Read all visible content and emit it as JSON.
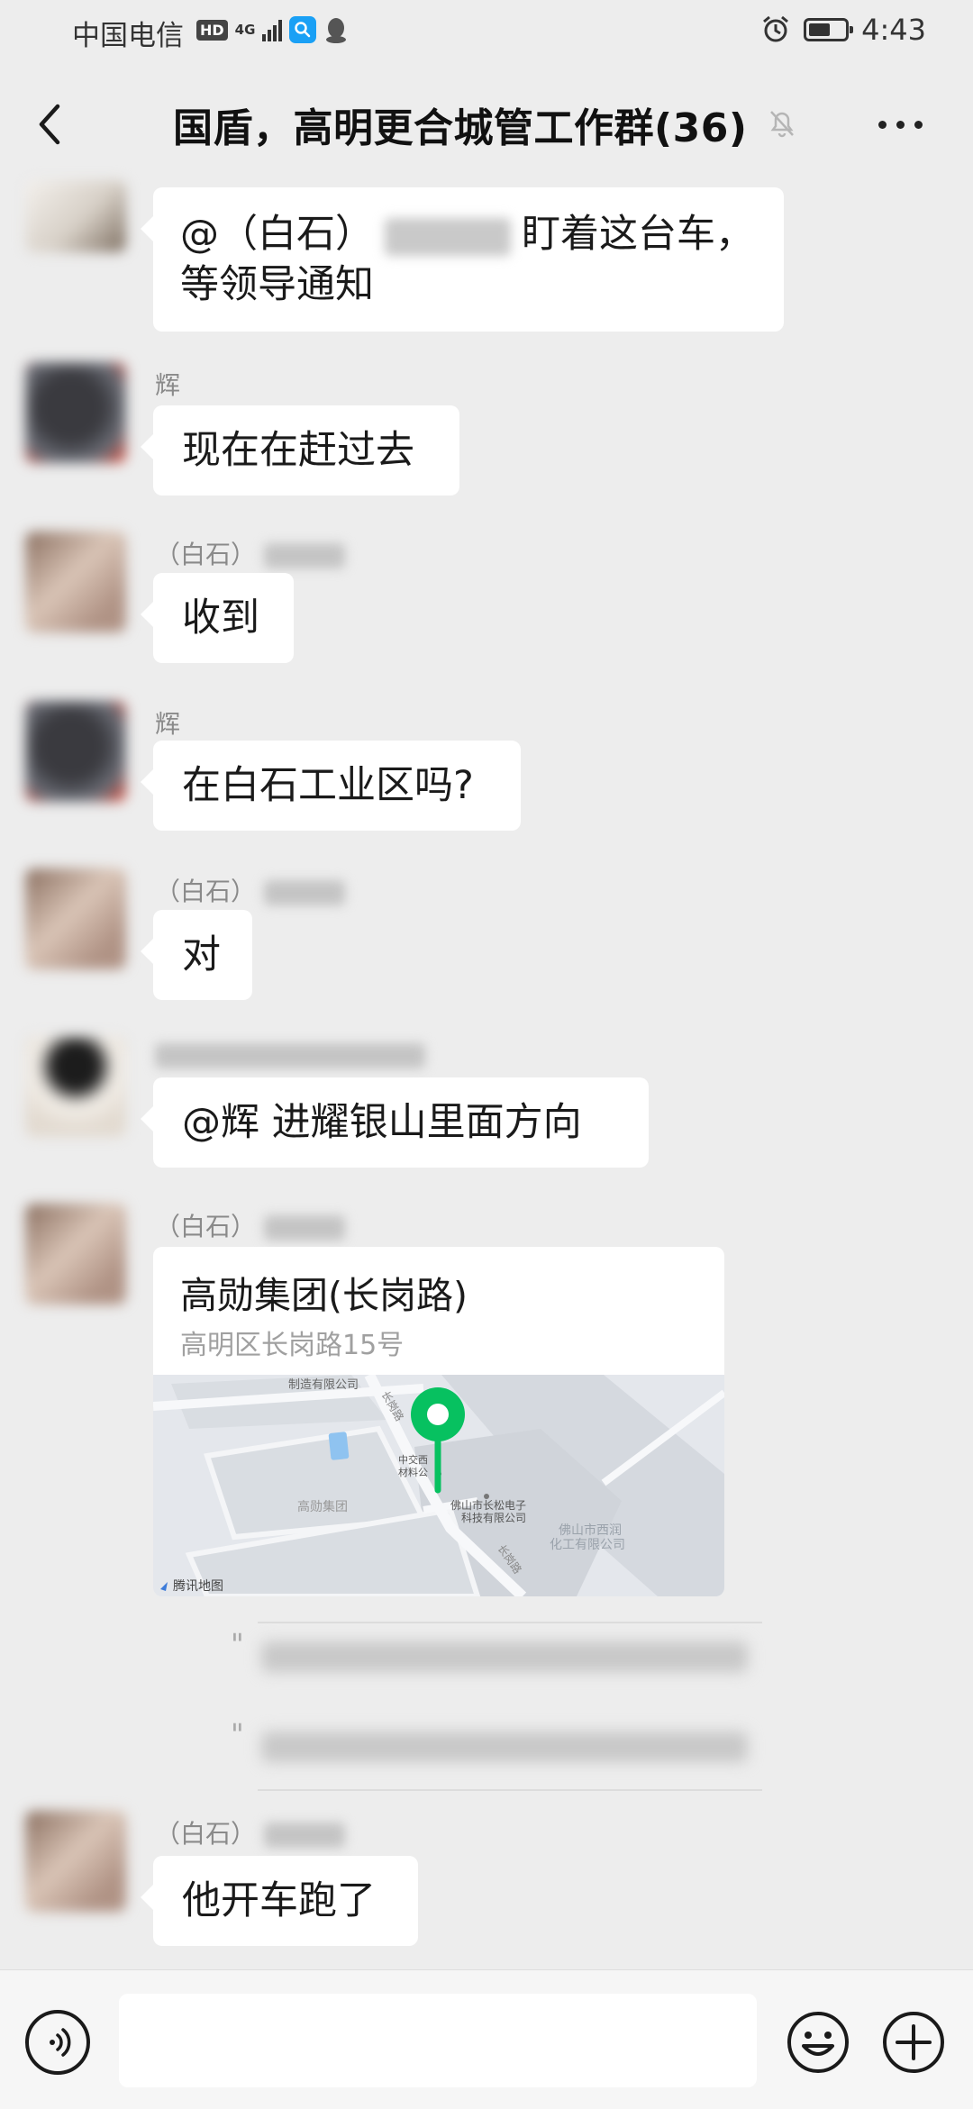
{
  "status_bar": {
    "carrier": "中国电信",
    "hd": "HD",
    "network": "4G",
    "time": "4:43",
    "battery_level": 0.6
  },
  "nav": {
    "title": "国盾，高明更合城管工作群(36)",
    "back_icon": "chevron-left-icon",
    "mute_icon": "bell-off-icon",
    "more_icon": "more-dots-icon"
  },
  "messages": [
    {
      "sender": "",
      "text_before": "@（白石）",
      "text_after": "盯着这台车，",
      "text_line2": "等领导通知"
    },
    {
      "sender": "辉",
      "text": "现在在赶过去"
    },
    {
      "sender": "（白石）",
      "text": "收到"
    },
    {
      "sender": "辉",
      "text": "在白石工业区吗?"
    },
    {
      "sender": "（白石）",
      "text": "对"
    },
    {
      "sender": "",
      "text": "@辉  进耀银山里面方向"
    },
    {
      "sender": "（白石）"
    },
    {
      "sender": "（白石）",
      "text": "他开车跑了"
    }
  ],
  "location": {
    "title": "高勋集团(长岗路)",
    "address": "高明区长岗路15号",
    "map_labels": {
      "company_top": "制造有限公司",
      "road1": "长岗路",
      "poi_center": "中交西",
      "poi_center2": "材料公",
      "group": "高勋集团",
      "company2_line1": "佛山市长松电子",
      "company2_line2": "科技有限公司",
      "company3_line1": "佛山市西润",
      "company3_line2": "化工有限公司",
      "road2": "长岗路",
      "attribution": "腾讯地图"
    }
  },
  "quotes": [
    {
      "mark": "\""
    },
    {
      "mark": "\""
    }
  ],
  "input_bar": {
    "placeholder": "",
    "voice_icon": "voice-icon",
    "emoji_icon": "emoji-icon",
    "plus_icon": "plus-icon"
  }
}
